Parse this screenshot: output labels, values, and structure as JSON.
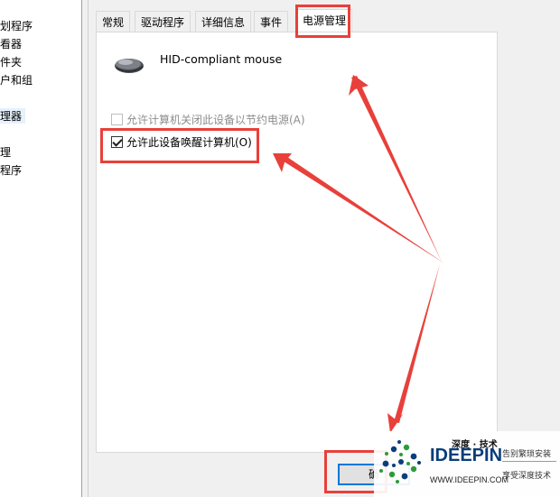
{
  "left_panel": {
    "items": [
      {
        "label": "划程序"
      },
      {
        "label": "看器"
      },
      {
        "label": "件夹"
      },
      {
        "label": "户和组"
      },
      {
        "label": "理器"
      },
      {
        "label": "理"
      },
      {
        "label": "程序"
      }
    ]
  },
  "dialog": {
    "tabs": [
      {
        "label": "常规"
      },
      {
        "label": "驱动程序"
      },
      {
        "label": "详细信息"
      },
      {
        "label": "事件"
      },
      {
        "label": "电源管理"
      }
    ],
    "active_tab": "电源管理",
    "device_icon": "mouse-icon",
    "device_name": "HID-compliant mouse",
    "options": [
      {
        "label": "允许计算机关闭此设备以节约电源(A)",
        "checked": false,
        "enabled": false
      },
      {
        "label": "允许此设备唤醒计算机(O)",
        "checked": true,
        "enabled": true
      }
    ],
    "ok_label": "确"
  },
  "watermark": {
    "brand_cn": "深度 · 技术",
    "brand": "IDEEPIN",
    "url": "WWW.IDEEPIN.COM",
    "slogan1": "告别繁琐安装",
    "slogan2": "享受深度技术"
  },
  "colors": {
    "highlight": "#e8403a",
    "watermark_blue": "#0a3d7a",
    "watermark_green": "#2e9b3a"
  }
}
